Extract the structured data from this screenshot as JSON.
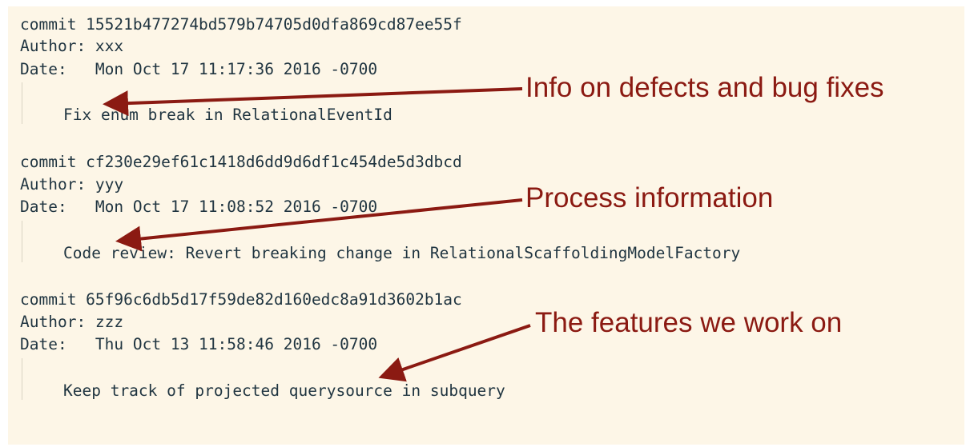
{
  "commits": [
    {
      "commit_line": "commit 15521b477274bd579b74705d0dfa869cd87ee55f",
      "author_line": "Author: xxx",
      "date_line": "Date:   Mon Oct 17 11:17:36 2016 -0700",
      "message": "Fix enum break in RelationalEventId"
    },
    {
      "commit_line": "commit cf230e29ef61c1418d6dd9d6df1c454de5d3dbcd",
      "author_line": "Author: yyy",
      "date_line": "Date:   Mon Oct 17 11:08:52 2016 -0700",
      "message": "Code review: Revert breaking change in RelationalScaffoldingModelFactory"
    },
    {
      "commit_line": "commit 65f96c6db5d17f59de82d160edc8a91d3602b1ac",
      "author_line": "Author: zzz",
      "date_line": "Date:   Thu Oct 13 11:58:46 2016 -0700",
      "message": "Keep track of projected querysource in subquery"
    }
  ],
  "annotations": [
    {
      "text": "Info on defects and bug fixes"
    },
    {
      "text": "Process information"
    },
    {
      "text": "The features we work on"
    }
  ],
  "colors": {
    "background": "#fdf6e7",
    "code_text": "#1f3440",
    "annotation": "#8b1a12"
  }
}
